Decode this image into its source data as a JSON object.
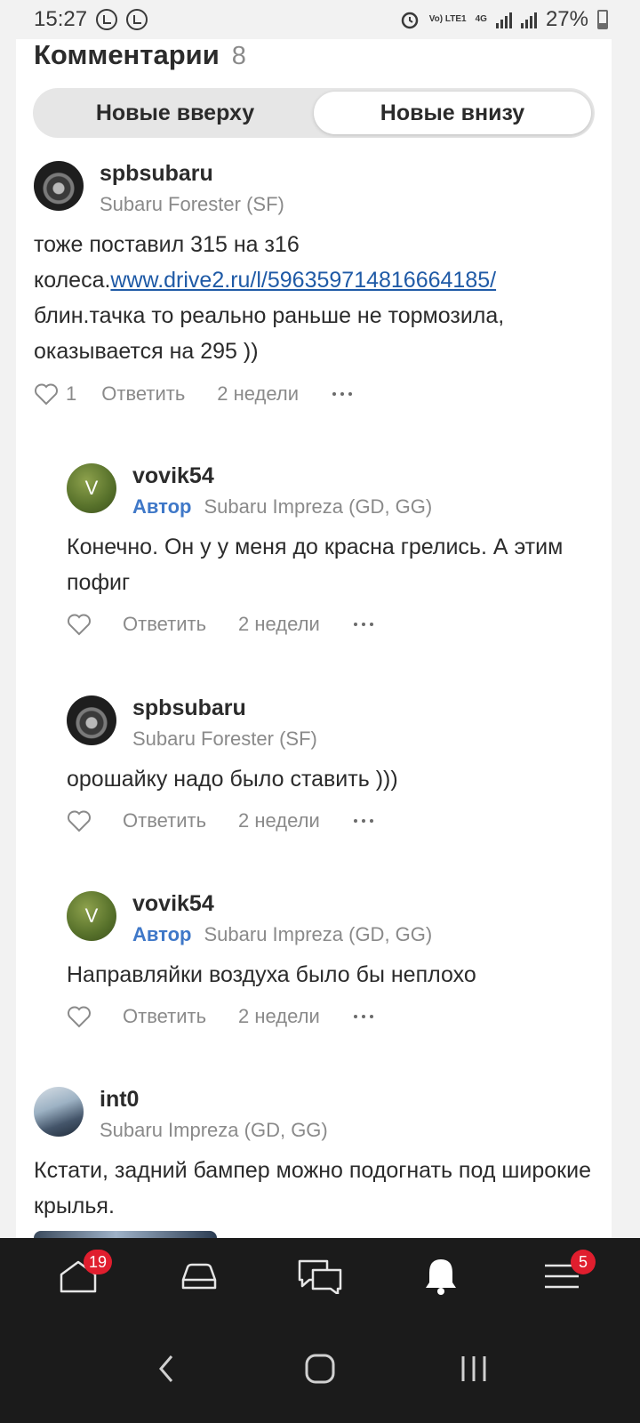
{
  "status_bar": {
    "time": "15:27",
    "network": "Vo) LTE1",
    "net_type": "4G",
    "battery": "27%"
  },
  "header": {
    "title": "Комментарии",
    "count": "8"
  },
  "sort": {
    "newest_top": "Новые вверху",
    "newest_bottom": "Новые внизу",
    "active": "newest_bottom"
  },
  "comments": [
    {
      "username": "spbsubaru",
      "car": "Subaru Forester (SF)",
      "text_before_link": "тоже поставил 315 на з16 колеса.",
      "link": "www.drive2.ru/l/596359714816664185/",
      "text_after_link": "блин.тачка то реально раньше не тормозила, оказывается на 295 ))",
      "likes": "1",
      "reply": "Ответить",
      "time": "2 недели"
    },
    {
      "username": "vovik54",
      "avatar_letter": "V",
      "badge": "Автор",
      "car": "Subaru Impreza (GD, GG)",
      "text": "Конечно. Он у у меня до красна грелись. А этим пофиг",
      "reply": "Ответить",
      "time": "2 недели"
    },
    {
      "username": "spbsubaru",
      "car": "Subaru Forester (SF)",
      "text": "орошайку надо было ставить )))",
      "reply": "Ответить",
      "time": "2 недели"
    },
    {
      "username": "vovik54",
      "avatar_letter": "V",
      "badge": "Автор",
      "car": "Subaru Impreza (GD, GG)",
      "text": "Направляйки воздуха было бы неплохо",
      "reply": "Ответить",
      "time": "2 недели"
    },
    {
      "username": "int0",
      "car": "Subaru Impreza (GD, GG)",
      "text": "Кстати, задний бампер можно подогнать под широкие крылья."
    }
  ],
  "bottom_nav": {
    "home_badge": "19",
    "menu_badge": "5",
    "items": [
      "home-icon",
      "car-icon",
      "chat-icon",
      "bell-icon",
      "menu-icon"
    ]
  },
  "colors": {
    "accent": "#3f78c8",
    "link": "#1f5aa6",
    "badge": "#e01e2e",
    "nav_bg": "#1b1b1b"
  }
}
